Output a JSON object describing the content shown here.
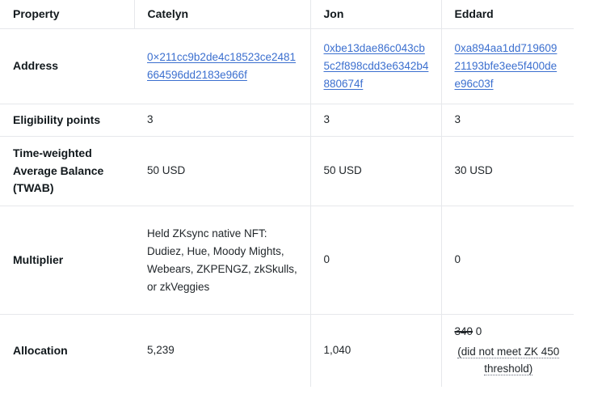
{
  "table": {
    "headers": [
      {
        "label": "Property"
      },
      {
        "label": "Catelyn"
      },
      {
        "label": "Jon"
      },
      {
        "label": "Eddard"
      }
    ],
    "rows": {
      "address": {
        "label": "Address",
        "catelyn": "0×211cc9b2de4c18523ce2481664596dd2183e966f",
        "jon": "0xbe13dae86c043cb5c2f898cdd3e6342b4880674f",
        "eddard": "0xa894aa1dd71960921193bfe3ee5f400dee96c03f"
      },
      "eligibility": {
        "label": "Eligibility points",
        "catelyn": "3",
        "jon": "3",
        "eddard": "3"
      },
      "twab": {
        "label": "Time-weighted Average Balance (TWAB)",
        "catelyn": "50 USD",
        "jon": "50 USD",
        "eddard": "30 USD"
      },
      "multiplier": {
        "label": "Multiplier",
        "catelyn": "Held ZKsync native NFT: Dudiez, Hue, Moody Mights, Webears, ZKPENGZ, zkSkulls, or zkVeggies",
        "jon": "0",
        "eddard": "0"
      },
      "allocation": {
        "label": "Allocation",
        "catelyn": "5,239",
        "jon": "1,040",
        "eddard_struck": "340",
        "eddard_value": "0",
        "eddard_note": "(did not meet ZK 450 threshold)"
      }
    }
  },
  "colors": {
    "link": "#3b6fcf",
    "border": "#e6e8eb",
    "text": "#22272b",
    "heading": "#11181c",
    "background": "#ffffff"
  }
}
